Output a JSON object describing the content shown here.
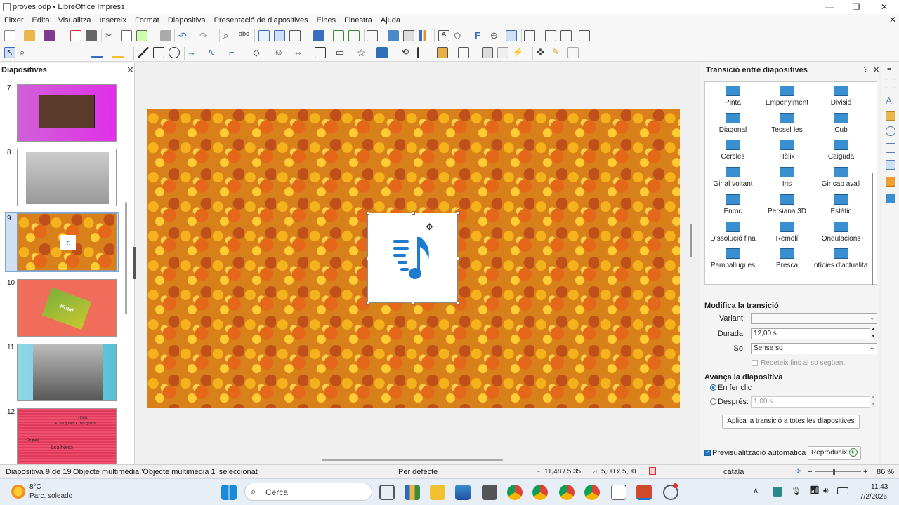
{
  "window": {
    "title": "proves.odp • LibreOffice Impress",
    "minimize": "—",
    "maximize": "❐",
    "close": "✕"
  },
  "menu": [
    "Fitxer",
    "Edita",
    "Visualitza",
    "Insereix",
    "Format",
    "Diapositiva",
    "Presentació de diapositives",
    "Eines",
    "Finestra",
    "Ajuda"
  ],
  "slides_panel": {
    "title": "Diapositives",
    "close": "✕",
    "slides": [
      {
        "number": "7"
      },
      {
        "number": "8"
      },
      {
        "number": "9"
      },
      {
        "number": "10",
        "text": "Hola!"
      },
      {
        "number": "11"
      },
      {
        "number": "12",
        "lines": [
          "• Hola",
          "• Dos quarts  • Tres quarts",
          "• En punt",
          "Les hores"
        ]
      }
    ]
  },
  "sidebar": {
    "title": "Transició entre diapositives",
    "help": "?",
    "close": "✕",
    "menu": "≡",
    "transitions": [
      "Pinta",
      "Empenyiment",
      "Divisió",
      "Diagonal",
      "Tessel·les",
      "Cub",
      "Cercles",
      "Hèlix",
      "Caiguda",
      "Gir al voltant",
      "Iris",
      "Gir cap avall",
      "Enroc",
      "Persiana 3D",
      "Estàtic",
      "Dissolució fina",
      "Remolí",
      "Ondulacions",
      "Pampallugues",
      "Bresca",
      "otícies d'actualitat"
    ],
    "modify_heading": "Modifica la transició",
    "variant_label": "Variant:",
    "variant_value": "",
    "duration_label": "Durada:",
    "duration_value": "12,00 s",
    "sound_label": "So:",
    "sound_value": "Sense so",
    "repeat_label": "Repeteix fins al so següent",
    "advance_heading": "Avança la diapositiva",
    "on_click_label": "En fer clic",
    "after_label": "Després:",
    "after_value": "1,00 s",
    "apply_all_button": "Aplica la transició a totes les diapositives",
    "auto_preview_label": "Previsualització automàtica",
    "play_button": "Reprodueix"
  },
  "status": {
    "slide": "Diapositiva 9 de 19",
    "selection": "Objecte multimèdia 'Objecte multimèdia 1' seleccionat",
    "master": "Per defecte",
    "position": "11,48 / 5,35",
    "size": "5,00 x 5,00",
    "language": "català",
    "zoom": "86 %"
  },
  "taskbar": {
    "weather_temp": "8°C",
    "weather_desc": "Parc. soleado",
    "search_placeholder": "Cerca",
    "time": "11:43",
    "date": "7/2/2026"
  },
  "colors": {
    "accent": "#1f7bd0",
    "leaf_orange": "#d8801a"
  }
}
